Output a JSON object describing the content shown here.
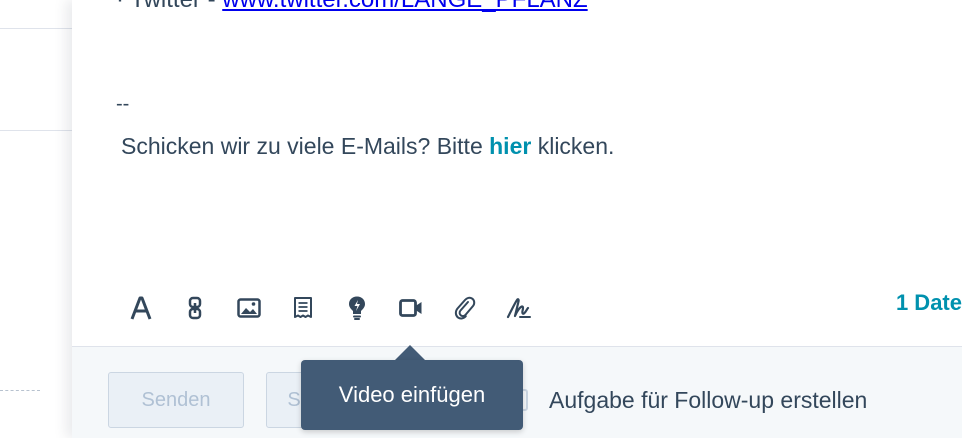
{
  "email_body": {
    "twitter_prefix": "· Twitter - ",
    "twitter_link": "www.twitter.com/LANGE_PFLANZ",
    "signature_separator": "--",
    "unsubscribe_before": "Schicken wir zu viele E-Mails? Bitte ",
    "unsubscribe_link": "hier",
    "unsubscribe_after": " klicken."
  },
  "toolbar": {
    "tools": [
      {
        "name": "text-format-icon"
      },
      {
        "name": "link-icon"
      },
      {
        "name": "image-icon"
      },
      {
        "name": "document-icon"
      },
      {
        "name": "lightbulb-icon"
      },
      {
        "name": "video-icon"
      },
      {
        "name": "paperclip-icon"
      },
      {
        "name": "signature-icon"
      }
    ],
    "attachment_count_label": "1 Date"
  },
  "tooltip": {
    "text": "Video einfügen"
  },
  "footer": {
    "send_label": "Senden",
    "second_button_label": "S",
    "followup_task_label": "Aufgabe für Follow-up erstellen"
  },
  "colors": {
    "text": "#33475b",
    "link": "#0091ae",
    "tooltip_bg": "#425b76",
    "disabled_button_bg": "#eaf0f6"
  }
}
